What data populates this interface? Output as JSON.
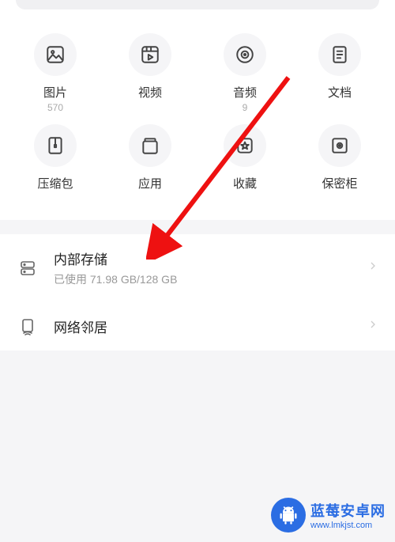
{
  "categories": [
    {
      "key": "pictures",
      "label": "图片",
      "count": "570"
    },
    {
      "key": "videos",
      "label": "视频",
      "count": ""
    },
    {
      "key": "audio",
      "label": "音频",
      "count": "9"
    },
    {
      "key": "documents",
      "label": "文档",
      "count": ""
    },
    {
      "key": "archives",
      "label": "压缩包",
      "count": ""
    },
    {
      "key": "apps",
      "label": "应用",
      "count": ""
    },
    {
      "key": "favorites",
      "label": "收藏",
      "count": ""
    },
    {
      "key": "safe",
      "label": "保密柜",
      "count": ""
    }
  ],
  "storage": {
    "title": "内部存储",
    "usage": "已使用 71.98 GB/128 GB"
  },
  "network": {
    "title": "网络邻居"
  },
  "watermark": {
    "line1": "蓝莓安卓网",
    "line2": "www.lmkjst.com"
  }
}
